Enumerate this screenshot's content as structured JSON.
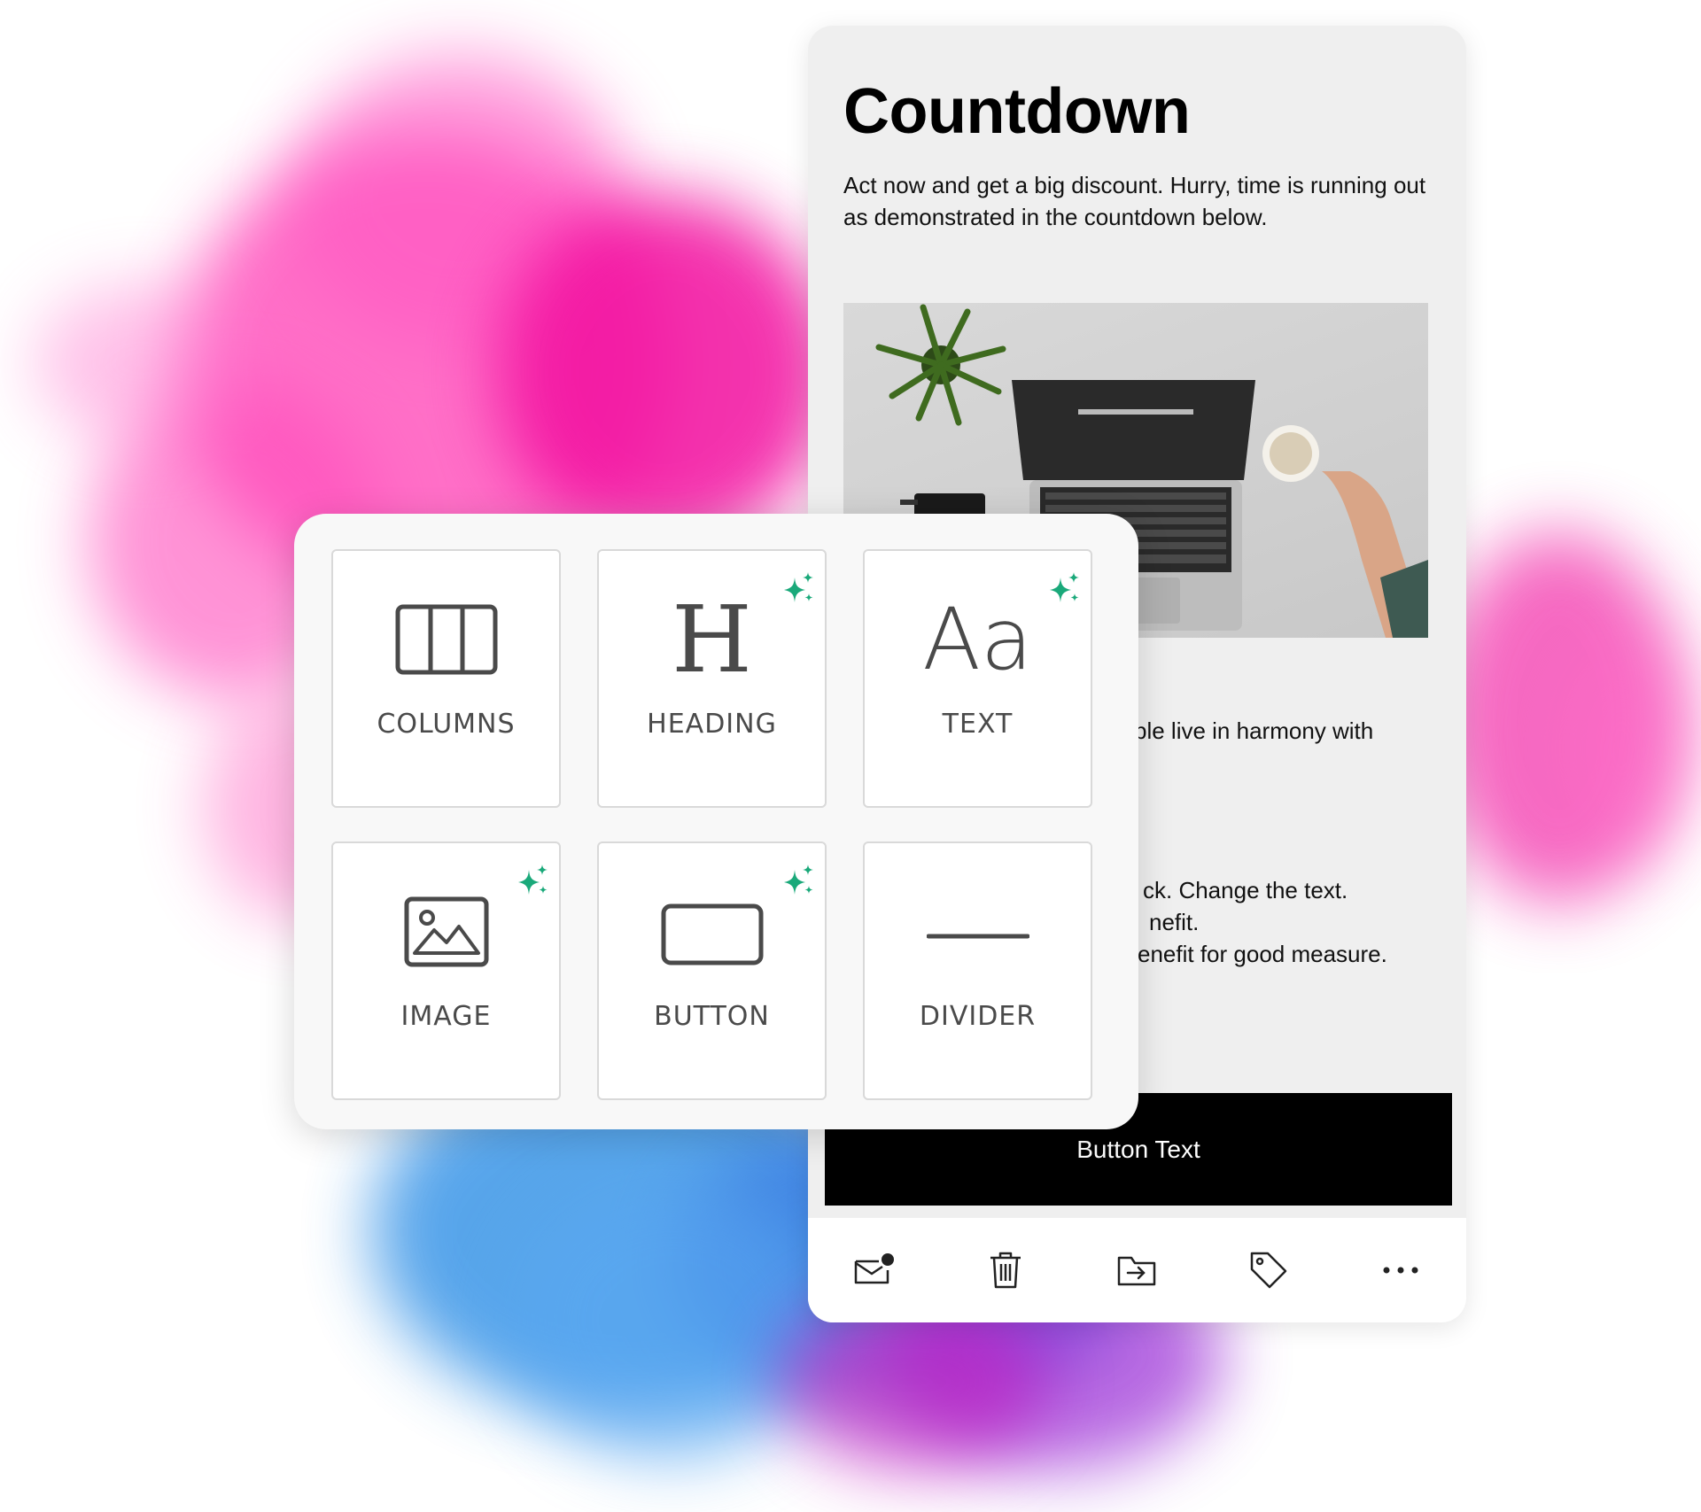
{
  "email": {
    "title": "Countdown",
    "intro": "Act now and get a big discount. Hurry, time is running out as demonstrated in the countdown below.",
    "partial_line_1": "ple live in harmony with",
    "partial_line_2": "ck. Change the text.",
    "partial_line_3": "nefit.",
    "partial_line_4": "enefit for good measure.",
    "button_label": "Button Text"
  },
  "palette": {
    "tiles": [
      {
        "label": "COLUMNS",
        "icon": "columns-icon",
        "sparkle": false
      },
      {
        "label": "HEADING",
        "icon": "heading-icon",
        "sparkle": true
      },
      {
        "label": "TEXT",
        "icon": "text-icon",
        "sparkle": true
      },
      {
        "label": "IMAGE",
        "icon": "image-icon",
        "sparkle": true
      },
      {
        "label": "BUTTON",
        "icon": "button-icon",
        "sparkle": true
      },
      {
        "label": "DIVIDER",
        "icon": "divider-icon",
        "sparkle": false
      }
    ],
    "heading_glyph": "H",
    "text_glyph": "Aa"
  },
  "toolbar": {
    "icons": [
      "mail-unread-icon",
      "trash-icon",
      "move-icon",
      "tag-icon",
      "more-icon"
    ]
  },
  "colors": {
    "sparkle": "#1aa97a",
    "icon_stroke": "#4a4a4a",
    "button_bg": "#000000",
    "card_bg": "#efefef"
  }
}
